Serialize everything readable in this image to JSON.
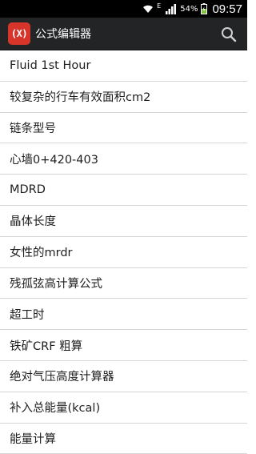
{
  "status_bar": {
    "network_letter": "E",
    "battery_percent": "54%",
    "time": "09:57"
  },
  "action_bar": {
    "logo_text": "(X)",
    "title": "公式编辑器",
    "search_icon": "search-icon"
  },
  "formulas": [
    "Fluid 1st Hour",
    "较复杂的行车有效面积cm2",
    "链条型号",
    "心墙0+420-403",
    "MDRD",
    "晶体长度",
    "女性的mrdr",
    "残孤弦高计算公式",
    "超工时",
    "铁矿CRF 粗算",
    "绝对气压高度计算器",
    "补入总能量(kcal)",
    "能量计算"
  ],
  "colors": {
    "status_bar_bg": "#000000",
    "action_bar_bg": "#222426",
    "logo_bg": "#d8352a",
    "divider": "#d6d6d6"
  }
}
